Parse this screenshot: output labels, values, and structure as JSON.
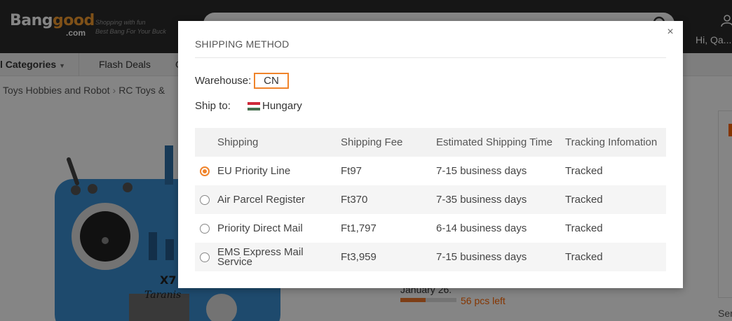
{
  "header": {
    "logo_text_a": "Bang",
    "logo_text_b": "good",
    "logo_suffix": ".com",
    "tagline_line1": "Shopping with fun",
    "tagline_line2": "Best Bang For Your Buck",
    "user_greeting": "Hi, Qa..."
  },
  "nav": {
    "categories_label": "l Categories",
    "flash_deals_label": "Flash Deals",
    "next_label": "G"
  },
  "breadcrumb": [
    "Toys Hobbies and Robot",
    "RC Toys &"
  ],
  "deal": {
    "date_text": "January 26.",
    "pcs_left": "56 pcs left",
    "progress": 0.45
  },
  "side": {
    "label": "Ser"
  },
  "modal": {
    "title": "SHIPPING METHOD",
    "close_symbol": "×",
    "warehouse_label": "Warehouse:",
    "warehouse_value": "CN",
    "ship_to_label": "Ship to:",
    "ship_to_country": "Hungary",
    "flag_colors": [
      "#ce2939",
      "#ffffff",
      "#477050"
    ],
    "accent_color": "#f0842b",
    "table": {
      "headers": [
        "Shipping",
        "Shipping Fee",
        "Estimated Shipping Time",
        "Tracking Infomation"
      ],
      "rows": [
        {
          "selected": true,
          "name": "EU Priority Line",
          "fee": "Ft97",
          "time": "7-15 business days",
          "tracking": "Tracked"
        },
        {
          "selected": false,
          "name": "Air Parcel Register",
          "fee": "Ft370",
          "time": "7-35 business days",
          "tracking": "Tracked"
        },
        {
          "selected": false,
          "name": "Priority Direct Mail",
          "fee": "Ft1,797",
          "time": "6-14 business days",
          "tracking": "Tracked"
        },
        {
          "selected": false,
          "name": "EMS Express Mail Service",
          "fee": "Ft3,959",
          "time": "7-15 business days",
          "tracking": "Tracked"
        }
      ]
    }
  }
}
